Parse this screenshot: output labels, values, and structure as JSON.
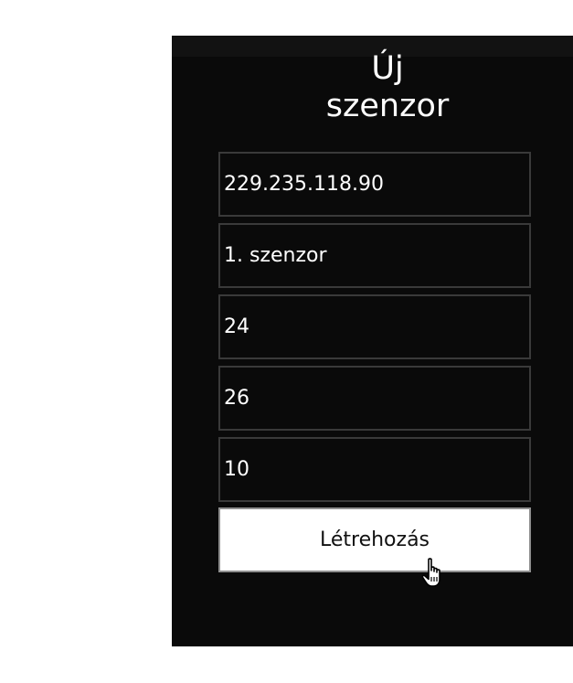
{
  "form": {
    "title_line1": "Új",
    "title_line2": "szenzor",
    "fields": {
      "ip_value": "229.235.118.90",
      "name_value": "1. szenzor",
      "field3_value": "24",
      "field4_value": "26",
      "field5_value": "10"
    },
    "submit_label": "Létrehozás"
  },
  "icons": {
    "cursor": "hand-pointer-icon"
  },
  "colors": {
    "panel_background": "#0a0a0a",
    "field_border": "#3a3a3a",
    "text": "#ffffff",
    "button_background": "#ffffff"
  }
}
